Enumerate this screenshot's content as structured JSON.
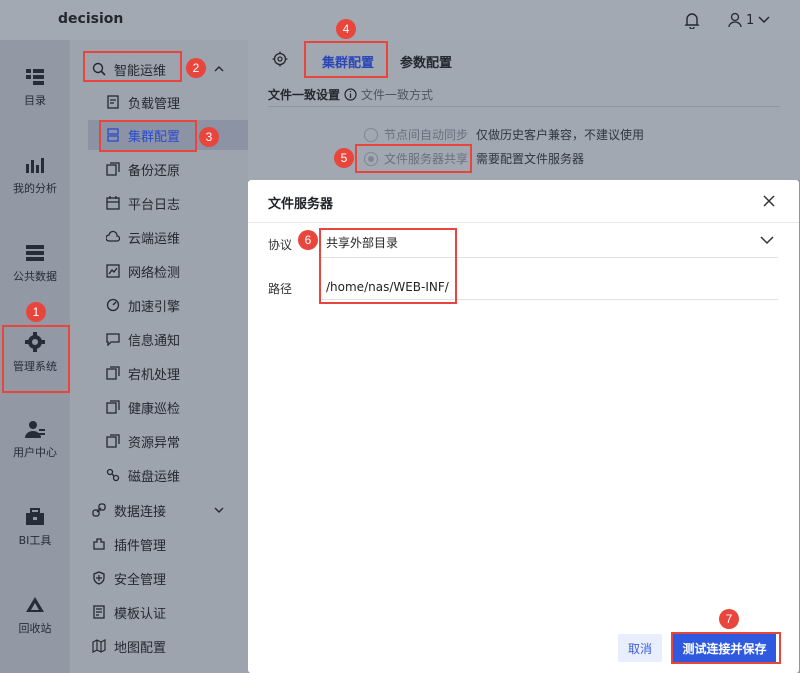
{
  "app": {
    "title": "decision",
    "user_label": "1"
  },
  "left_nav": [
    {
      "label": "目录",
      "icon": "directory-icon"
    },
    {
      "label": "我的分析",
      "icon": "analysis-chart-icon"
    },
    {
      "label": "公共数据",
      "icon": "database-icon"
    },
    {
      "label": "管理系统",
      "icon": "gear-icon"
    },
    {
      "label": "用户中心",
      "icon": "user-icon"
    },
    {
      "label": "BI工具",
      "icon": "toolbox-icon"
    },
    {
      "label": "回收站",
      "icon": "recycle-icon"
    }
  ],
  "sub_nav": {
    "group": "智能运维",
    "items": [
      {
        "label": "负载管理",
        "icon": "load-icon"
      },
      {
        "label": "集群配置",
        "icon": "cluster-icon"
      },
      {
        "label": "备份还原",
        "icon": "backup-icon"
      },
      {
        "label": "平台日志",
        "icon": "calendar-icon"
      },
      {
        "label": "云端运维",
        "icon": "cloud-icon"
      },
      {
        "label": "网络检测",
        "icon": "network-icon"
      },
      {
        "label": "加速引擎",
        "icon": "engine-icon"
      },
      {
        "label": "信息通知",
        "icon": "message-icon"
      },
      {
        "label": "宕机处理",
        "icon": "copy-icon"
      },
      {
        "label": "健康巡检",
        "icon": "copy-icon"
      },
      {
        "label": "资源异常",
        "icon": "copy-icon"
      },
      {
        "label": "磁盘运维",
        "icon": "disk-icon"
      }
    ],
    "bottom": [
      {
        "label": "数据连接",
        "icon": "link-icon"
      },
      {
        "label": "插件管理",
        "icon": "plugin-icon"
      },
      {
        "label": "安全管理",
        "icon": "shield-icon"
      },
      {
        "label": "模板认证",
        "icon": "template-icon"
      },
      {
        "label": "地图配置",
        "icon": "map-icon"
      }
    ]
  },
  "tabs": {
    "active": "集群配置",
    "other": "参数配置"
  },
  "section": {
    "title": "文件一致设置",
    "subtitle": "文件一致方式",
    "options": [
      {
        "label": "节点间自动同步",
        "hint": "仅做历史客户兼容，不建议使用",
        "selected": false
      },
      {
        "label": "文件服务器共享",
        "hint": "需要配置文件服务器",
        "selected": true
      }
    ]
  },
  "dialog": {
    "title": "文件服务器",
    "protocol_label": "协议",
    "protocol_value": "共享外部目录",
    "path_label": "路径",
    "path_value": "/home/nas/WEB-INF/",
    "cancel_label": "取消",
    "save_label": "测试连接并保存"
  },
  "badges": [
    "1",
    "2",
    "3",
    "4",
    "5",
    "6",
    "7"
  ],
  "colors": {
    "accent": "#2f5ae0",
    "highlight": "#e8453c"
  }
}
